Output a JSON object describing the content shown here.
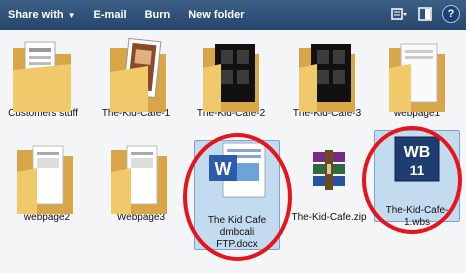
{
  "toolbar": {
    "share_with": "Share with",
    "email": "E-mail",
    "burn": "Burn",
    "new_folder": "New folder"
  },
  "items": [
    {
      "label": "Customers stuff",
      "kind": "folder-docs"
    },
    {
      "label": "The-Kid-Cafe-1",
      "kind": "folder-photo"
    },
    {
      "label": "The-Kid-Cafe-2",
      "kind": "folder-film"
    },
    {
      "label": "The-Kid-Cafe-3",
      "kind": "folder-film"
    },
    {
      "label": "webpage1",
      "kind": "folder-docs"
    },
    {
      "label": "webpage2",
      "kind": "folder-docs"
    },
    {
      "label": "Webpage3",
      "kind": "folder-docs"
    },
    {
      "label": "The Kid Cafe dmbcali FTP.docx",
      "kind": "word-file"
    },
    {
      "label": "The-Kid-Cafe.zip",
      "kind": "zip-file"
    },
    {
      "label": "The-Kid-Cafe-1.wbs",
      "kind": "wbs-file"
    }
  ],
  "word_icon_text": "W",
  "wbs_icon_text": "WB",
  "wbs_icon_number": "11",
  "help_glyph": "?",
  "colors": {
    "toolbar": "#2f5079",
    "folder": "#e6bd62",
    "selection": "#a9cdee",
    "circle": "#e8141b"
  }
}
